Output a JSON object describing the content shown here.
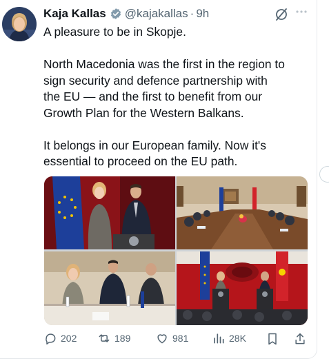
{
  "tweet": {
    "author_name": "Kaja Kallas",
    "handle": "@kajakallas",
    "separator": "·",
    "time": "9h",
    "lines": [
      "A pleasure to be in Skopje.",
      "",
      "North Macedonia was the first in the region to",
      "sign security and defence partnership with",
      "the EU — and the first to benefit from our",
      "Growth Plan for the Western Balkans.",
      "",
      "It belongs in our European family. Now it's",
      "essential to proceed on the EU path."
    ]
  },
  "media": {
    "photos": [
      "photo-handshake",
      "photo-conference-table",
      "photo-meeting",
      "photo-press-podiums"
    ]
  },
  "actions": {
    "replies": "202",
    "reposts": "189",
    "likes": "981",
    "views": "28K"
  },
  "icons": {
    "verified": "verified-badge-icon",
    "grok": "grok-icon",
    "more": "more-icon",
    "reply": "reply-icon",
    "repost": "repost-icon",
    "like": "like-icon",
    "views": "views-icon",
    "bookmark": "bookmark-icon",
    "share": "share-icon"
  },
  "colors": {
    "text": "#0f1419",
    "secondary": "#536471",
    "verified": "#829aab",
    "eu_blue": "#1d3f9a",
    "mk_red": "#d2232a"
  }
}
